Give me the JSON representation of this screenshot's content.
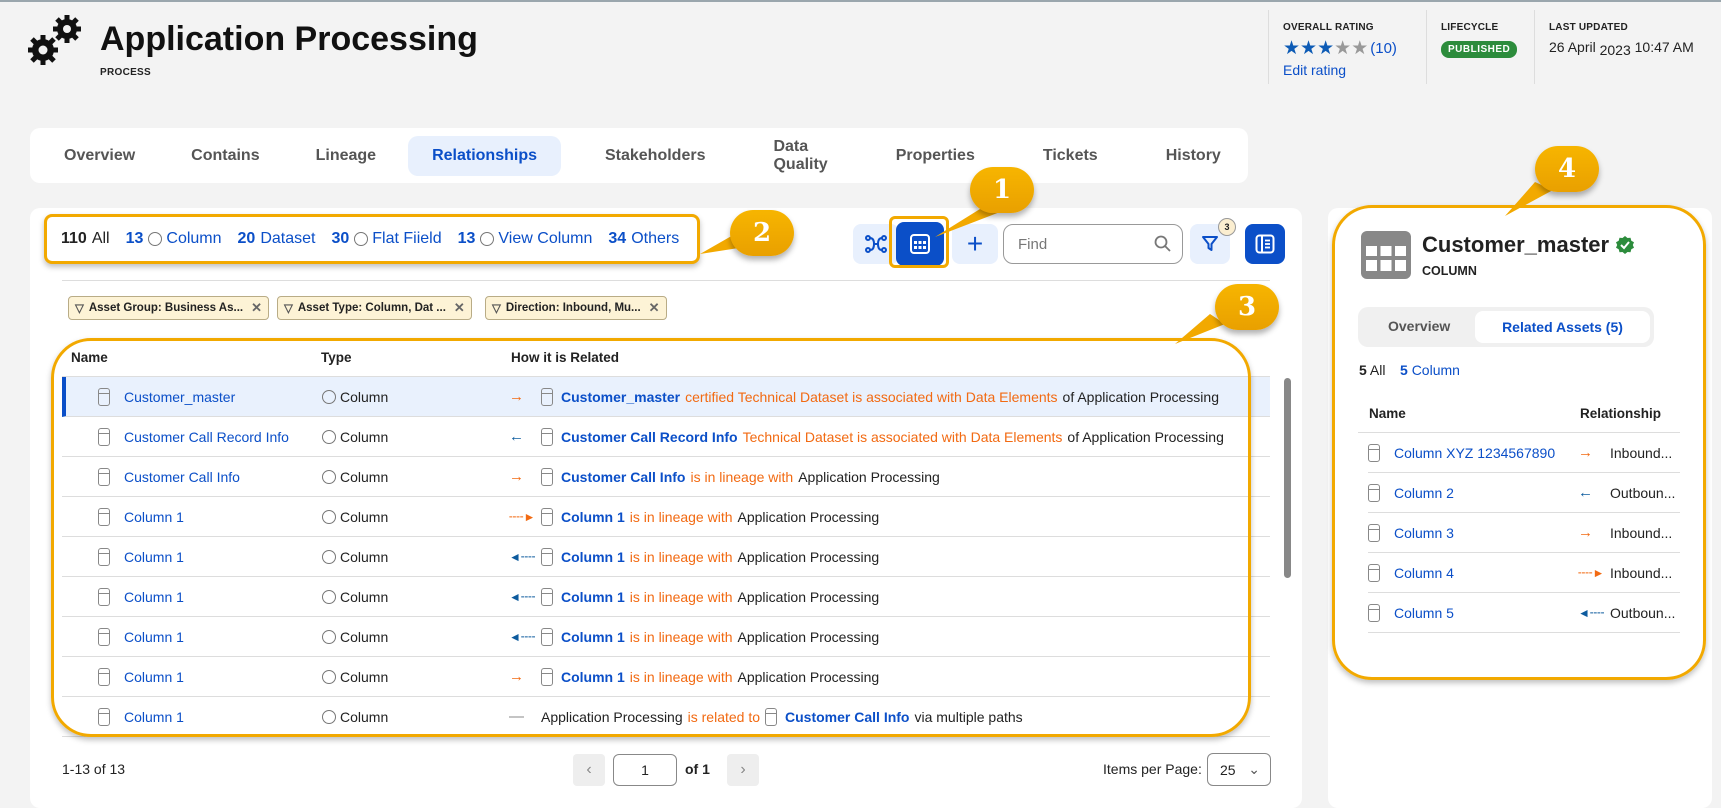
{
  "header": {
    "title": "Application Processing",
    "subtitle": "PROCESS",
    "icon": "gears-icon",
    "rating": {
      "label": "OVERALL RATING",
      "value": 3,
      "max": 5,
      "count": "(10)",
      "edit": "Edit rating"
    },
    "lifecycle": {
      "label": "LIFECYCLE",
      "value": "PUBLISHED"
    },
    "updated": {
      "label": "LAST UPDATED",
      "date": "26 April",
      "year": "2023",
      "time": "10:47 AM"
    }
  },
  "tabs": [
    "Overview",
    "Contains",
    "Lineage",
    "Relationships",
    "Stakeholders",
    "Data Quality",
    "Properties",
    "Tickets",
    "History"
  ],
  "active_tab": "Relationships",
  "counts": [
    {
      "n": "110",
      "label": "All"
    },
    {
      "n": "13",
      "label": "Column",
      "radio": true
    },
    {
      "n": "20",
      "label": "Dataset"
    },
    {
      "n": "30",
      "label": "Flat Fiield",
      "radio": true
    },
    {
      "n": "13",
      "label": "View Column",
      "radio": true
    },
    {
      "n": "34",
      "label": "Others"
    }
  ],
  "toolbar": {
    "find_placeholder": "Find",
    "filter_badge": "3"
  },
  "chips": [
    "Asset Group: Business As...",
    "Asset Type: Column, Dat ...",
    "Direction: Inbound, Mu..."
  ],
  "table": {
    "headers": [
      "Name",
      "Type",
      "How it is Related"
    ],
    "rows": [
      {
        "name": "Customer_master",
        "type": "Column",
        "dir": "out",
        "asset": "Customer_master",
        "rel": "certified Technical Dataset is associated with Data Elements",
        "tail": "of Application Processing"
      },
      {
        "name": "Customer Call Record Info",
        "type": "Column",
        "dir": "in",
        "asset": "Customer Call Record Info",
        "rel": "Technical Dataset is associated with Data Elements",
        "tail": "of Application Processing"
      },
      {
        "name": "Customer Call Info",
        "type": "Column",
        "dir": "out",
        "asset": "Customer Call Info",
        "rel": "is in lineage with",
        "tail": "Application Processing"
      },
      {
        "name": "Column 1",
        "type": "Column",
        "dir": "out-dash",
        "asset": "Column 1",
        "rel": "is in lineage with",
        "tail": "Application Processing"
      },
      {
        "name": "Column 1",
        "type": "Column",
        "dir": "in-dash",
        "asset": "Column 1",
        "rel": "is in lineage with",
        "tail": "Application Processing"
      },
      {
        "name": "Column 1",
        "type": "Column",
        "dir": "in-dash",
        "asset": "Column 1",
        "rel": "is in lineage with",
        "tail": "Application Processing"
      },
      {
        "name": "Column 1",
        "type": "Column",
        "dir": "in-dash",
        "asset": "Column 1",
        "rel": "is in lineage with",
        "tail": "Application Processing"
      },
      {
        "name": "Column 1",
        "type": "Column",
        "dir": "out",
        "asset": "Column 1",
        "rel": "is in lineage with",
        "tail": "Application Processing"
      },
      {
        "name": "Column 1",
        "type": "Column",
        "dir": "none",
        "pre": "Application Processing",
        "rel": "is related to",
        "asset": "Customer Call Info",
        "tail": "via multiple paths"
      }
    ]
  },
  "pager": {
    "range": "1-13 of 13",
    "page": "1",
    "of": "of 1",
    "ipp_label": "Items per Page:",
    "ipp": "25"
  },
  "annotations": [
    "1",
    "2",
    "3",
    "4"
  ],
  "detail": {
    "title": "Customer_master",
    "type": "COLUMN",
    "tabs": [
      "Overview",
      "Related Assets (5)"
    ],
    "counts": [
      {
        "n": "5",
        "label": "All"
      },
      {
        "n": "5",
        "label": "Column"
      }
    ],
    "headers": [
      "Name",
      "Relationship"
    ],
    "rows": [
      {
        "name": "Column XYZ 1234567890",
        "dir": "out",
        "rel": "Inbound..."
      },
      {
        "name": "Column 2",
        "dir": "in",
        "rel": "Outboun..."
      },
      {
        "name": "Column 3",
        "dir": "out",
        "rel": "Inbound..."
      },
      {
        "name": "Column 4",
        "dir": "out-dash",
        "rel": "Inbound..."
      },
      {
        "name": "Column 5",
        "dir": "in-dash",
        "rel": "Outboun..."
      }
    ]
  },
  "colors": {
    "accent": "#0b4fc8",
    "orange": "#f26a12",
    "annotation": "#f2a900",
    "published": "#2c8c3c"
  }
}
